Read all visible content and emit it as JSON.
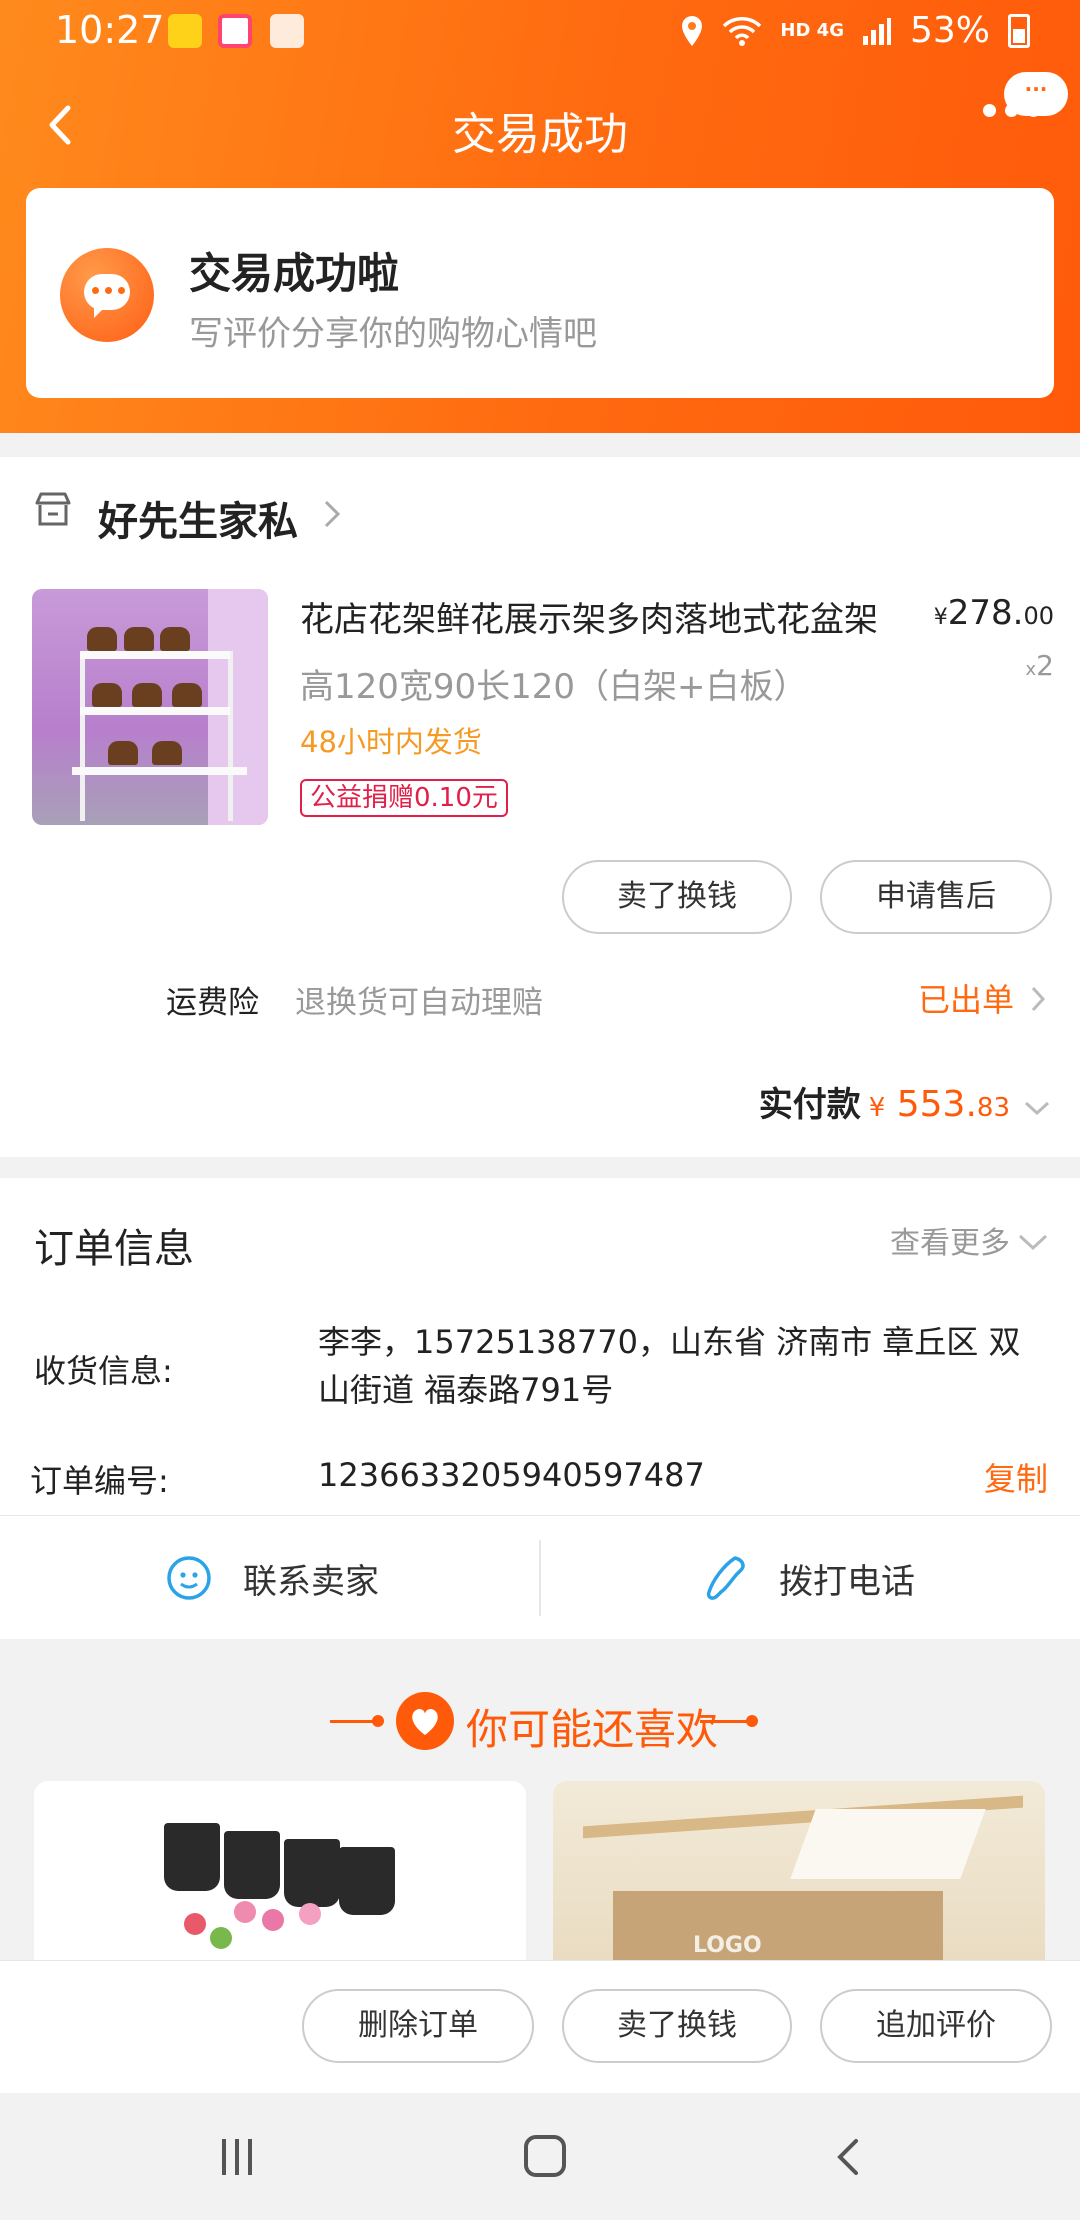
{
  "status_bar": {
    "time": "10:27",
    "network": "HD 4G",
    "battery": "53%"
  },
  "nav": {
    "title": "交易成功",
    "more_bubble": "···"
  },
  "success": {
    "title": "交易成功啦",
    "subtitle": "写评价分享你的购物心情吧"
  },
  "store": {
    "name": "好先生家私"
  },
  "product": {
    "title": "花店花架鲜花展示架多肉落地式花盆架",
    "price_symbol": "¥",
    "price_int": "278.",
    "price_cents": "00",
    "qty_x": "x",
    "qty": "2",
    "spec": "高120宽90长120（白架+白板）",
    "shipping": "48小时内发货",
    "charity": "公益捐赠0.10元"
  },
  "product_actions": {
    "sell": "卖了换钱",
    "after_sale": "申请售后"
  },
  "insurance": {
    "label": "运费险",
    "desc": "退换货可自动理赔",
    "status": "已出单"
  },
  "payment": {
    "label": "实付款",
    "symbol": "¥",
    "amount_int": "553.",
    "amount_cents": "83"
  },
  "order_info": {
    "title": "订单信息",
    "more": "查看更多",
    "receiver_label": "收货信息:",
    "receiver_value": "李李，15725138770，山东省 济南市 章丘区 双山街道 福泰路791号",
    "order_no_label": "订单编号:",
    "order_no": "1236633205940597487",
    "copy": "复制"
  },
  "contact": {
    "seller": "联系卖家",
    "phone": "拨打电话"
  },
  "recommend": {
    "title": "你可能还喜欢",
    "card2_logo": "LOGO"
  },
  "bottom_actions": {
    "delete": "删除订单",
    "sell": "卖了换钱",
    "review": "追加评价"
  },
  "colors": {
    "accent": "#ff6a10",
    "charity": "#e0204a",
    "shipping": "#f59a23",
    "link_blue": "#2aa3e8"
  }
}
